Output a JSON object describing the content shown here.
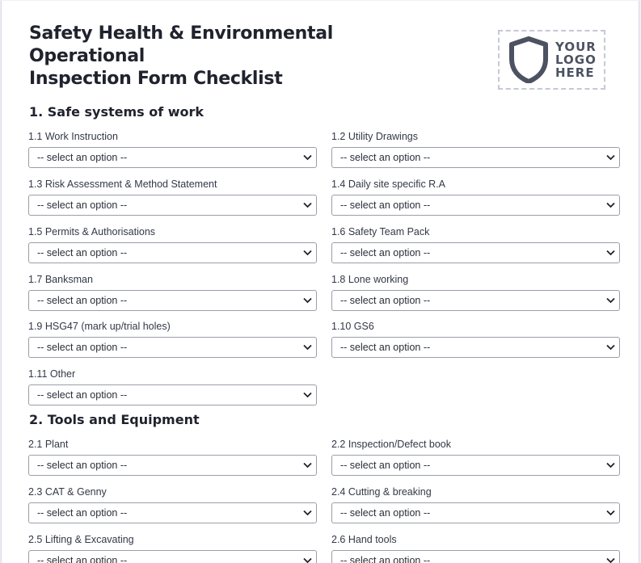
{
  "form": {
    "title_line1": "Safety Health & Environmental Operational",
    "title_line2": "Inspection Form Checklist",
    "logo": {
      "line1": "YOUR",
      "line2": "LOGO",
      "line3": "HERE",
      "icon": "shield-icon"
    },
    "placeholder": "-- select an option --",
    "accent_color": "#4d5262"
  },
  "sections": [
    {
      "title": "1. Safe systems of work",
      "fields": [
        {
          "label": "1.1 Work Instruction",
          "value": "-- select an option --"
        },
        {
          "label": "1.2 Utility Drawings",
          "value": "-- select an option --"
        },
        {
          "label": "1.3 Risk Assessment & Method Statement",
          "value": "-- select an option --"
        },
        {
          "label": "1.4 Daily site specific R.A",
          "value": "-- select an option --"
        },
        {
          "label": "1.5 Permits & Authorisations",
          "value": "-- select an option --"
        },
        {
          "label": "1.6 Safety Team Pack",
          "value": "-- select an option --"
        },
        {
          "label": "1.7 Banksman",
          "value": "-- select an option --"
        },
        {
          "label": "1.8 Lone working",
          "value": "-- select an option --"
        },
        {
          "label": "1.9 HSG47 (mark up/trial holes)",
          "value": "-- select an option --"
        },
        {
          "label": "1.10 GS6",
          "value": "-- select an option --"
        },
        {
          "label": "1.11 Other",
          "value": "-- select an option --"
        }
      ]
    },
    {
      "title": "2. Tools and Equipment",
      "fields": [
        {
          "label": "2.1 Plant",
          "value": "-- select an option --"
        },
        {
          "label": "2.2 Inspection/Defect book",
          "value": "-- select an option --"
        },
        {
          "label": "2.3 CAT & Genny",
          "value": "-- select an option --"
        },
        {
          "label": "2.4 Cutting & breaking",
          "value": "-- select an option --"
        },
        {
          "label": "2.5 Lifting & Excavating",
          "value": "-- select an option --"
        },
        {
          "label": "2.6 Hand tools",
          "value": "-- select an option --"
        }
      ]
    }
  ]
}
